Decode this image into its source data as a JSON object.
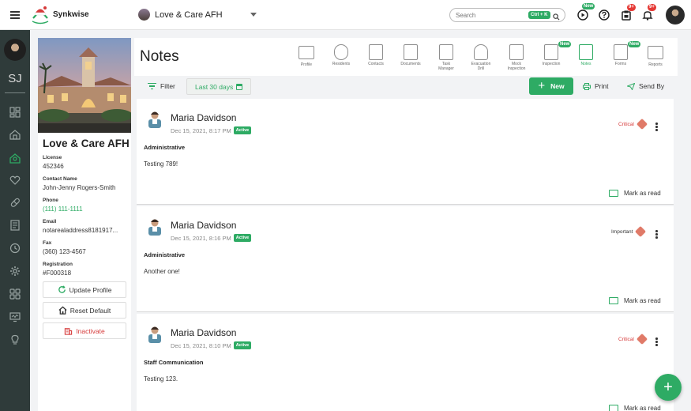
{
  "app": {
    "name": "Synkwise"
  },
  "topbar": {
    "facility_name": "Love & Care AFH",
    "search_placeholder": "Search",
    "search_shortcut": "Ctrl + K",
    "play_badge": "New",
    "tasks_badge": "9+",
    "notifications_badge": "9+"
  },
  "rail": {
    "initials": "SJ",
    "icons": [
      "dashboard-icon",
      "building-icon",
      "residents-icon",
      "heart-icon",
      "pill-icon",
      "clipboard-icon",
      "clock-icon",
      "settings-icon",
      "grid-icon",
      "monitor-icon",
      "bulb-icon"
    ]
  },
  "profile": {
    "name": "Love & Care AFH",
    "fields": [
      {
        "label": "License",
        "value": "452346"
      },
      {
        "label": "Contact Name",
        "value": "John-Jenny Rogers-Smith"
      },
      {
        "label": "Phone",
        "value": "(111) 111-1111"
      },
      {
        "label": "Email",
        "value": "notarealaddress8181917..."
      },
      {
        "label": "Fax",
        "value": "(360) 123-4567"
      },
      {
        "label": "Registration",
        "value": "#F000318"
      }
    ],
    "buttons": {
      "update": "Update Profile",
      "reset": "Reset Default",
      "inactivate": "Inactivate"
    }
  },
  "header": {
    "title": "Notes",
    "modules": [
      {
        "label": "Profile",
        "badge": ""
      },
      {
        "label": "Residents",
        "badge": ""
      },
      {
        "label": "Contacts",
        "badge": ""
      },
      {
        "label": "Documents",
        "badge": ""
      },
      {
        "label": "Task Manager",
        "badge": ""
      },
      {
        "label": "Evacuation Drill",
        "badge": ""
      },
      {
        "label": "Mock Inspection",
        "badge": ""
      },
      {
        "label": "Inspection",
        "badge": "New"
      },
      {
        "label": "Notes",
        "badge": ""
      },
      {
        "label": "Forms",
        "badge": "New"
      },
      {
        "label": "Reports",
        "badge": ""
      }
    ]
  },
  "toolbar": {
    "filter_label": "Filter",
    "range_label": "Last 30 days",
    "new_label": "New",
    "print_label": "Print",
    "send_label": "Send By"
  },
  "notes": [
    {
      "author": "Maria Davidson",
      "date": "Dec 15, 2021, 8:17 PM",
      "status": "Active",
      "priority": "Critical",
      "category": "Administrative",
      "body": "Testing 789!",
      "action": "Mark as read"
    },
    {
      "author": "Maria Davidson",
      "date": "Dec 15, 2021, 8:16 PM",
      "status": "Active",
      "priority": "Important",
      "category": "Administrative",
      "body": "Another one!",
      "action": "Mark as read"
    },
    {
      "author": "Maria Davidson",
      "date": "Dec 15, 2021, 8:10 PM",
      "status": "Active",
      "priority": "Critical",
      "category": "Staff Communication",
      "body": "Testing 123.",
      "action": "Mark as read"
    }
  ],
  "fab_label": "+",
  "colors": {
    "accent": "#2eab64",
    "critical": "#d63a3a",
    "rail": "#2f3b3a",
    "badge": "#e53935"
  }
}
